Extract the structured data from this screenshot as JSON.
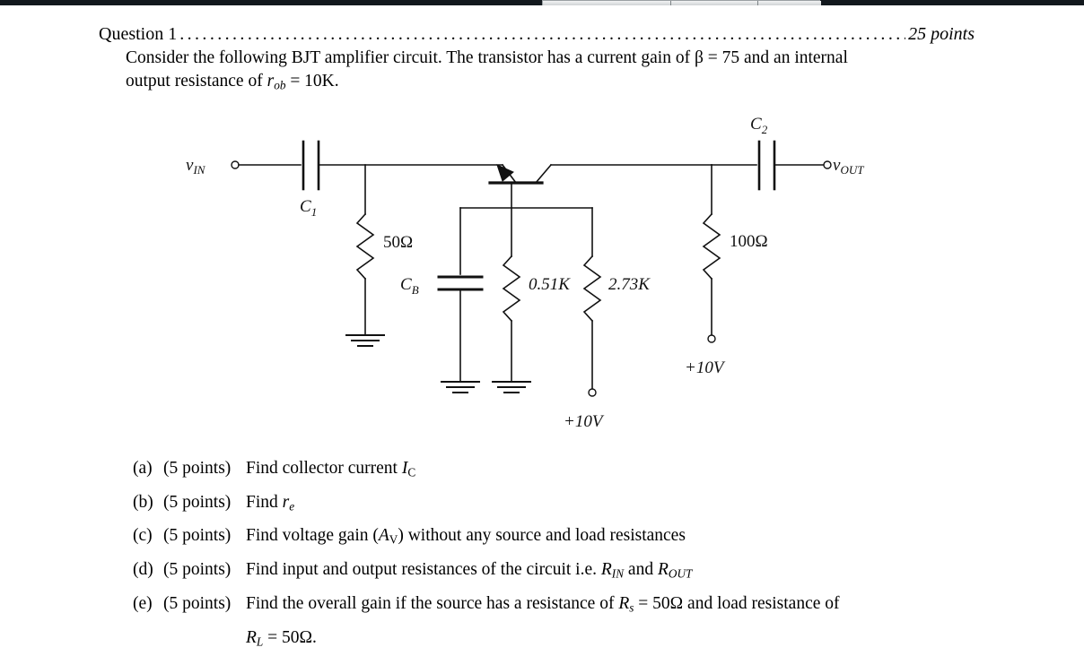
{
  "window": {
    "scrollbar_name": "horizontal-scrollbar"
  },
  "question": {
    "title": "Question 1",
    "leader": "........................................................................................................",
    "points": "25 points",
    "body_line1": "Consider the following BJT amplifier circuit. The transistor has a current gain of β = 75 and an internal",
    "body_line2_prefix": "output resistance of ",
    "body_line2_var": "r",
    "body_line2_sub": "ob",
    "body_line2_suffix": " = 10K."
  },
  "circuit": {
    "title": "bjt-amplifier-circuit",
    "labels": {
      "v_in": "v",
      "v_in_sub": "IN",
      "v_out": "v",
      "v_out_sub": "OUT",
      "c1": "C",
      "c1_sub": "1",
      "c2": "C",
      "c2_sub": "2",
      "cb": "C",
      "cb_sub": "B",
      "r_source": "50Ω",
      "r_base1": "0.51K",
      "r_base2": "2.73K",
      "r_collector": "100Ω",
      "supply_center": "+10V",
      "supply_right": "+10V"
    },
    "components": [
      {
        "name": "input-terminal",
        "label": "vIN"
      },
      {
        "name": "coupling-capacitor-c1",
        "label": "C1"
      },
      {
        "name": "resistor-50-ohm",
        "label": "50Ω"
      },
      {
        "name": "ground-symbol-source",
        "label": ""
      },
      {
        "name": "bypass-capacitor-cb",
        "label": "CB"
      },
      {
        "name": "ground-symbol-cb",
        "label": ""
      },
      {
        "name": "resistor-0-51k",
        "label": "0.51K"
      },
      {
        "name": "ground-symbol-r1",
        "label": ""
      },
      {
        "name": "resistor-2-73k",
        "label": "2.73K"
      },
      {
        "name": "supply-terminal-center",
        "label": "+10V"
      },
      {
        "name": "bjt-transistor",
        "label": ""
      },
      {
        "name": "resistor-100-ohm",
        "label": "100Ω"
      },
      {
        "name": "supply-terminal-right",
        "label": "+10V"
      },
      {
        "name": "coupling-capacitor-c2",
        "label": "C2"
      },
      {
        "name": "output-terminal",
        "label": "vOUT"
      }
    ]
  },
  "parts": [
    {
      "label": "(a)",
      "points": "(5 points)",
      "text_prefix": "Find collector current ",
      "var": "I",
      "var_sub": "C",
      "text_suffix": ""
    },
    {
      "label": "(b)",
      "points": "(5 points)",
      "text_prefix": "Find ",
      "var": "r",
      "var_sub": "e",
      "text_suffix": ""
    },
    {
      "label": "(c)",
      "points": "(5 points)",
      "text_prefix": "Find voltage gain (",
      "var": "A",
      "var_sub": "V",
      "text_suffix": ") without any source and load resistances"
    },
    {
      "label": "(d)",
      "points": "(5 points)",
      "text_prefix": "Find input and output resistances of the circuit i.e. ",
      "var": "R",
      "var_sub": "IN",
      "text_suffix": " and ",
      "var2": "R",
      "var2_sub": "OUT"
    },
    {
      "label": "(e)",
      "points": "(5 points)",
      "text_prefix": "Find the overall gain if the source has a resistance of ",
      "var": "R",
      "var_sub": "s",
      "text_suffix": " = 50Ω and load resistance of",
      "continuation_var": "R",
      "continuation_sub": "L",
      "continuation_text": " = 50Ω."
    }
  ],
  "colors": {
    "ink": "#000000",
    "page_background": "#ffffff",
    "chrome": "#12181d"
  }
}
